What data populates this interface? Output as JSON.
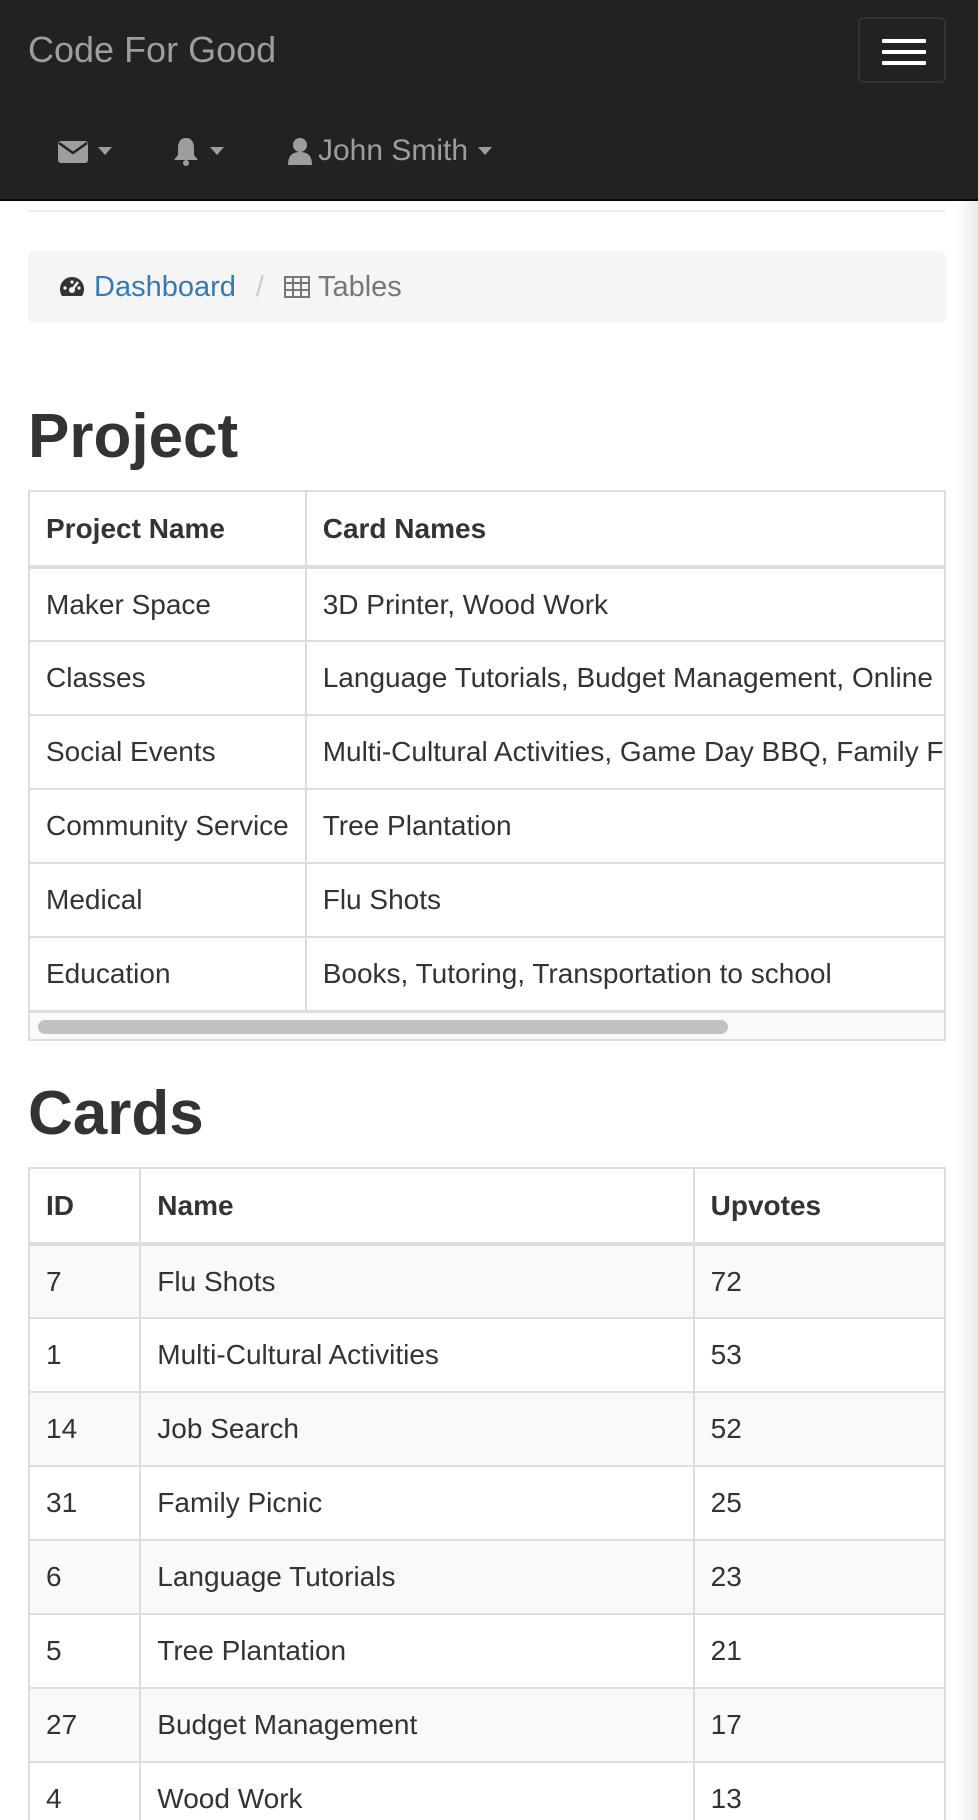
{
  "navbar": {
    "brand": "Code For Good",
    "user_name": "John Smith",
    "icons": [
      "envelope-icon",
      "bell-icon",
      "user-icon",
      "menu-icon"
    ]
  },
  "breadcrumb": {
    "dashboard": "Dashboard",
    "separator": "/",
    "current": "Tables"
  },
  "project": {
    "title": "Project",
    "headers": [
      "Project Name",
      "Card Names"
    ],
    "rows": [
      [
        "Maker Space",
        "3D Printer, Wood Work"
      ],
      [
        "Classes",
        "Language Tutorials, Budget Management, Online"
      ],
      [
        "Social Events",
        "Multi-Cultural Activities, Game Day BBQ, Family F"
      ],
      [
        "Community Service",
        "Tree Plantation"
      ],
      [
        "Medical",
        "Flu Shots"
      ],
      [
        "Education",
        "Books, Tutoring, Transportation to school"
      ]
    ]
  },
  "cards": {
    "title": "Cards",
    "headers": [
      "ID",
      "Name",
      "Upvotes"
    ],
    "rows": [
      [
        "7",
        "Flu Shots",
        "72"
      ],
      [
        "1",
        "Multi-Cultural Activities",
        "53"
      ],
      [
        "14",
        "Job Search",
        "52"
      ],
      [
        "31",
        "Family Picnic",
        "25"
      ],
      [
        "6",
        "Language Tutorials",
        "23"
      ],
      [
        "5",
        "Tree Plantation",
        "21"
      ],
      [
        "27",
        "Budget Management",
        "17"
      ],
      [
        "4",
        "Wood Work",
        "13"
      ]
    ]
  }
}
